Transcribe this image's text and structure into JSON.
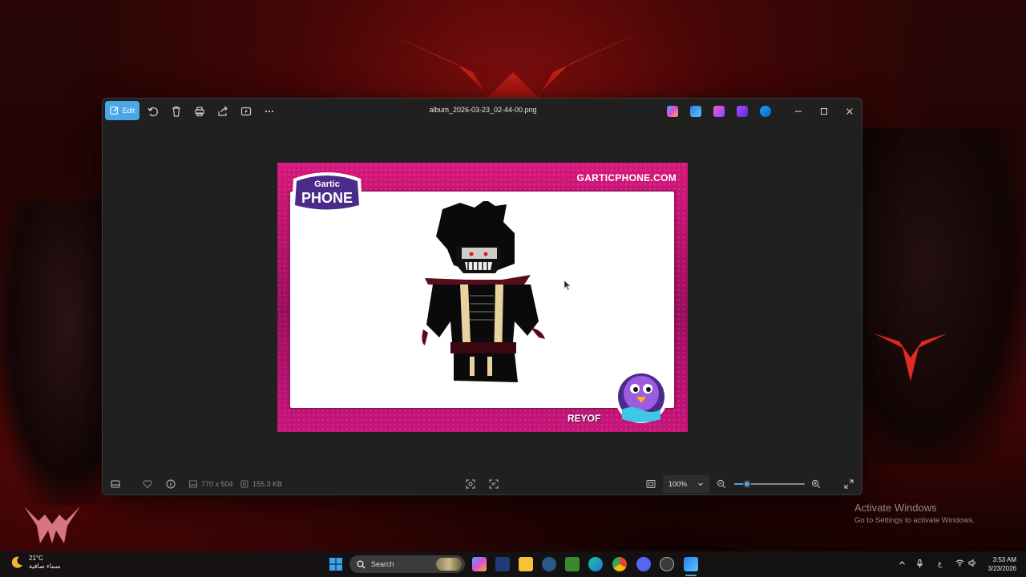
{
  "window": {
    "file_title": "album_2026-03-23_02-44-00.png",
    "edit_label": "Edit"
  },
  "image": {
    "site": "GARTICPHONE.COM",
    "logo_top": "Gartic",
    "logo_bottom": "PHONE",
    "author": "REYOF"
  },
  "bottombar": {
    "dimensions": "770 x 504",
    "filesize": "155.3 KB",
    "zoom": "100%",
    "zoom_level": 0.18
  },
  "activate": {
    "line1": "Activate Windows",
    "line2": "Go to Settings to activate Windows."
  },
  "taskbar": {
    "temp": "21°C",
    "weather_desc": "سماء صافية",
    "search_label": "Search",
    "lang": "ع",
    "time": "3:53 AM",
    "date": "3/23/2026"
  },
  "colors": {
    "accent": "#4aa7e8",
    "card_pink": "#d6187c"
  }
}
